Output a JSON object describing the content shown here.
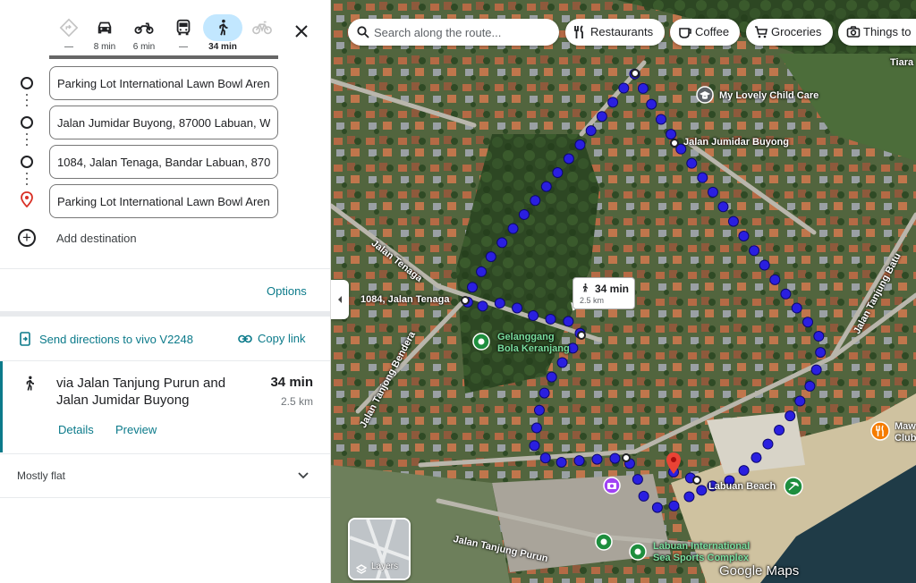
{
  "travel_modes": [
    {
      "name": "best",
      "icon": "directions-icon",
      "label": "—",
      "active": false,
      "disabled": true
    },
    {
      "name": "driving",
      "icon": "car-icon",
      "label": "8 min",
      "active": false,
      "disabled": false
    },
    {
      "name": "motorcycle",
      "icon": "motorcycle-icon",
      "label": "6 min",
      "active": false,
      "disabled": false
    },
    {
      "name": "transit",
      "icon": "bus-icon",
      "label": "—",
      "active": false,
      "disabled": false
    },
    {
      "name": "walking",
      "icon": "walk-icon",
      "label": "34 min",
      "active": true,
      "disabled": false
    },
    {
      "name": "cycling",
      "icon": "bicycle-icon",
      "label": "",
      "active": false,
      "disabled": true
    }
  ],
  "stops": [
    {
      "value": "Parking Lot International Lawn Bowl Arena"
    },
    {
      "value": "Jalan Jumidar Buyong, 87000 Labuan, W"
    },
    {
      "value": "1084, Jalan Tenaga, Bandar Labuan, 8700"
    },
    {
      "value": "Parking Lot International Lawn Bowl Arena"
    }
  ],
  "add_destination": "Add destination",
  "options_label": "Options",
  "send_directions": "Send directions to vivo V2248",
  "copy_link": "Copy link",
  "route": {
    "via": "via Jalan Tanjung Purun and Jalan Jumidar Buyong",
    "time": "34 min",
    "distance": "2.5 km",
    "details": "Details",
    "preview": "Preview"
  },
  "terrain_note": "Mostly flat",
  "map": {
    "search_placeholder": "Search along the route...",
    "chips": [
      "Restaurants",
      "Coffee",
      "Groceries",
      "Things to"
    ],
    "labels": {
      "child_care": "My Lovely Child Care",
      "jumidar": "Jalan Jumidar Buyong",
      "tenaga_stop": "1084, Jalan Tenaga",
      "tenaga_road": "Jalan Tenaga",
      "bandera": "Jalan Tanjong Bendera",
      "tanjung_batu": "Jalan Tanjung Batu",
      "gelanggang": "Gelanggang Bola Keranjang",
      "beach": "Labuan Beach",
      "sea_sports": "Labuan International Sea Sports Complex",
      "tanjung_purun": "Jalan Tanjung Purun",
      "tiara": "Tiara",
      "maw": "Maw Club"
    },
    "bubble_time": "34 min",
    "bubble_distance": "2.5 km",
    "layers_label": "Layers",
    "logo": "Google Maps",
    "colors": {
      "route": "#2a1fe0",
      "teal": "#0b7a8a"
    }
  }
}
